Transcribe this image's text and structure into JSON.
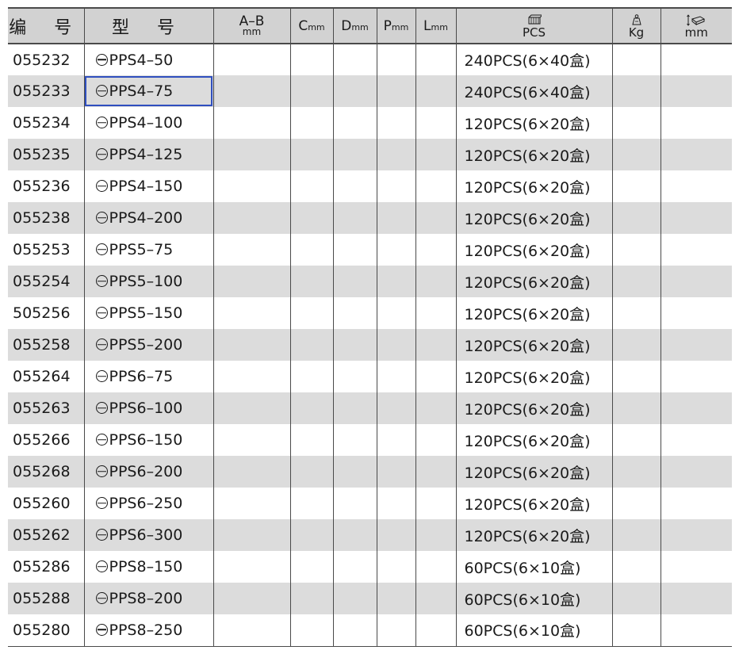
{
  "headers": {
    "code": "编 号",
    "model": "型 号",
    "ab_top": "A–B",
    "ab_unit": "mm",
    "c_letter": "C",
    "c_unit": "mm",
    "d_letter": "D",
    "d_unit": "mm",
    "p_letter": "P",
    "p_unit": "mm",
    "l_letter": "L",
    "l_unit": "mm",
    "pcs_unit": "PCS",
    "kg_unit": "Kg",
    "size_unit": "mm"
  },
  "icons": {
    "pcs": "package-box-icon",
    "kg": "weight-scale-icon",
    "size": "dimension-box-icon"
  },
  "colors": {
    "header_bg": "#d2d2d2",
    "stripe_bg": "#dcdcdc",
    "selection_border": "#2f4fbf"
  },
  "selected_row": 1,
  "rows": [
    {
      "code": "055232",
      "model": "PPS4–50",
      "pcs": "240PCS(6×40盒)"
    },
    {
      "code": "055233",
      "model": "PPS4–75",
      "pcs": "240PCS(6×40盒)"
    },
    {
      "code": "055234",
      "model": "PPS4–100",
      "pcs": "120PCS(6×20盒)"
    },
    {
      "code": "055235",
      "model": "PPS4–125",
      "pcs": "120PCS(6×20盒)"
    },
    {
      "code": "055236",
      "model": "PPS4–150",
      "pcs": "120PCS(6×20盒)"
    },
    {
      "code": "055238",
      "model": "PPS4–200",
      "pcs": "120PCS(6×20盒)"
    },
    {
      "code": "055253",
      "model": "PPS5–75",
      "pcs": "120PCS(6×20盒)"
    },
    {
      "code": "055254",
      "model": "PPS5–100",
      "pcs": "120PCS(6×20盒)"
    },
    {
      "code": "505256",
      "model": "PPS5–150",
      "pcs": "120PCS(6×20盒)"
    },
    {
      "code": "055258",
      "model": "PPS5–200",
      "pcs": "120PCS(6×20盒)"
    },
    {
      "code": "055264",
      "model": "PPS6–75",
      "pcs": "120PCS(6×20盒)"
    },
    {
      "code": "055263",
      "model": "PPS6–100",
      "pcs": "120PCS(6×20盒)"
    },
    {
      "code": "055266",
      "model": "PPS6–150",
      "pcs": "120PCS(6×20盒)"
    },
    {
      "code": "055268",
      "model": "PPS6–200",
      "pcs": "120PCS(6×20盒)"
    },
    {
      "code": "055260",
      "model": "PPS6–250",
      "pcs": "120PCS(6×20盒)"
    },
    {
      "code": "055262",
      "model": "PPS6–300",
      "pcs": "120PCS(6×20盒)"
    },
    {
      "code": "055286",
      "model": "PPS8–150",
      "pcs": "60PCS(6×10盒)"
    },
    {
      "code": "055288",
      "model": "PPS8–200",
      "pcs": "60PCS(6×10盒)"
    },
    {
      "code": "055280",
      "model": "PPS8–250",
      "pcs": "60PCS(6×10盒)"
    }
  ]
}
